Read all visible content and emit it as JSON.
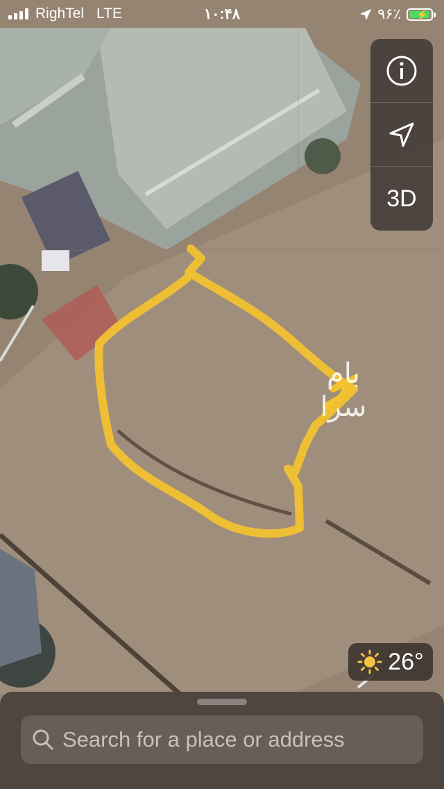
{
  "status_bar": {
    "carrier": "RighTel",
    "network": "LTE",
    "time": "۱۰:۴۸",
    "battery_percent": "۹۶٪",
    "battery_level": 0.96,
    "accent_battery": "#4cd964"
  },
  "map": {
    "annotation_text_line1": "بام",
    "annotation_text_line2": "سرا",
    "outline_color": "#f2c230"
  },
  "map_controls": {
    "info_icon": "info-icon",
    "location_icon": "location-arrow-icon",
    "view_3d_label": "3D"
  },
  "weather": {
    "icon": "sun-icon",
    "temperature": "26°"
  },
  "search": {
    "placeholder": "Search for a place or address",
    "icon": "search-icon"
  }
}
